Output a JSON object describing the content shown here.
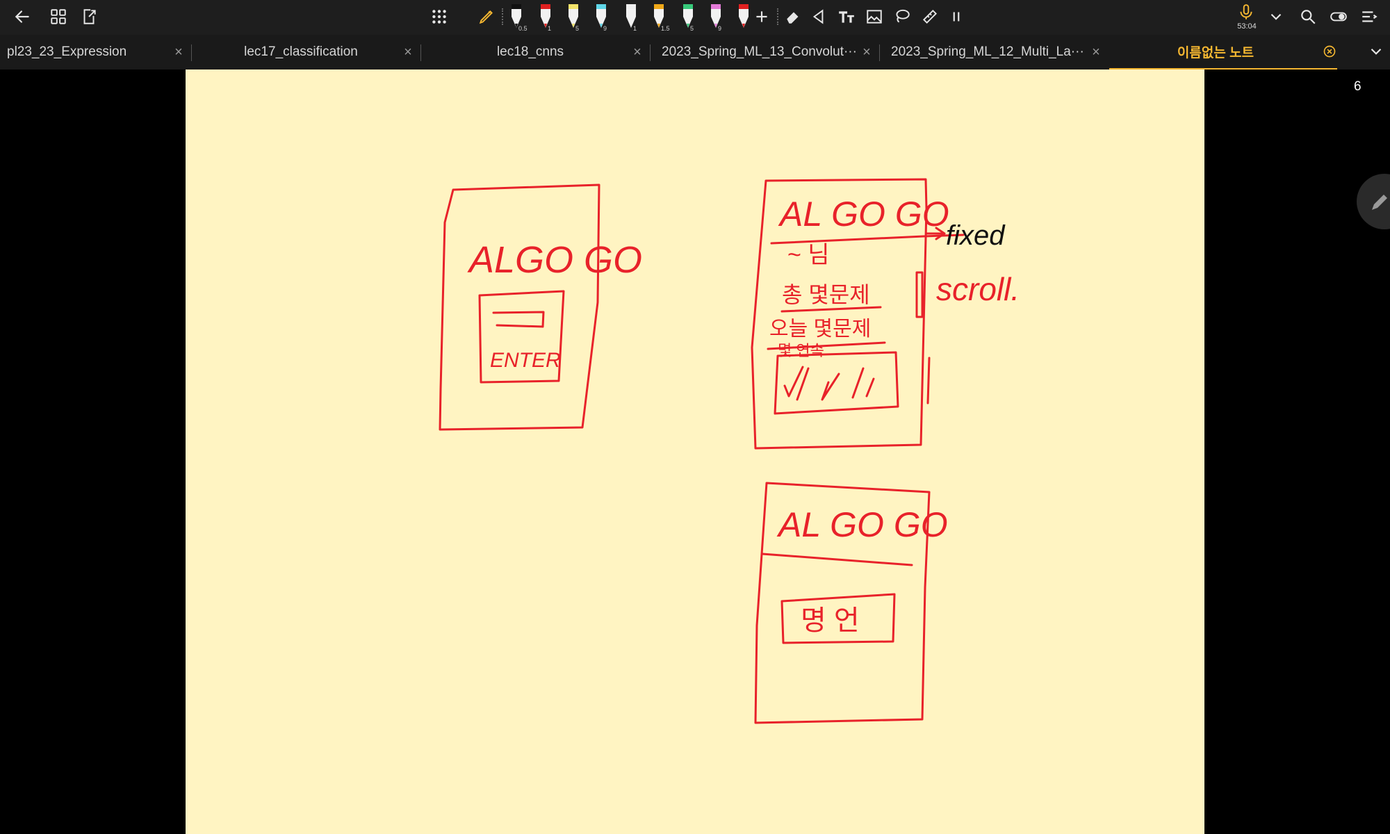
{
  "toolbar": {
    "left_icons": [
      "back-arrow-icon",
      "grid-view-icon",
      "export-icon"
    ],
    "pens": [
      {
        "name": "black-pen",
        "color": "#111111",
        "size": "0.5"
      },
      {
        "name": "red-pen",
        "color": "#e02020",
        "size": "1"
      },
      {
        "name": "yellow-highlighter",
        "color": "#f3e36a",
        "size": "5"
      },
      {
        "name": "cyan-highlighter",
        "color": "#5fd6e8",
        "size": "9"
      },
      {
        "name": "white-fountain-pen",
        "color": "#eeeeee",
        "size": "1"
      },
      {
        "name": "orange-fountain-pen",
        "color": "#f0a818",
        "size": "1.5"
      },
      {
        "name": "green-highlighter",
        "color": "#37c97a",
        "size": "5"
      },
      {
        "name": "pink-highlighter",
        "color": "#e47ad8",
        "size": "9"
      },
      {
        "name": "red-highlighter",
        "color": "#e02020",
        "size": ""
      }
    ],
    "right_tools": [
      "eraser-icon",
      "selection-icon",
      "text-tool-icon",
      "image-icon",
      "lasso-icon",
      "ruler-icon",
      "pause-icon"
    ],
    "timer": "53:04"
  },
  "tabs": [
    {
      "label": "pl23_23_Expression",
      "active": false
    },
    {
      "label": "lec17_classification",
      "active": false
    },
    {
      "label": "lec18_cnns",
      "active": false
    },
    {
      "label": "2023_Spring_ML_13_Convolut···",
      "active": false
    },
    {
      "label": "2023_Spring_ML_12_Multi_La···",
      "active": false
    },
    {
      "label": "이름없는 노트",
      "active": true
    }
  ],
  "tab_count": "6",
  "colors": {
    "accent": "#f5b731",
    "ink": "#e8222a",
    "paper": "#fff4c2"
  },
  "sketch": {
    "mock1": {
      "title": "ALGO GO",
      "button": "ENTER"
    },
    "mock2": {
      "title": "AL GO GO",
      "lines": [
        "~ 님",
        "총 몇문제",
        "오늘 몇문제",
        "몇 연속"
      ],
      "note_fixed": "fixed",
      "note_scroll": "scroll."
    },
    "mock3": {
      "title": "AL GO GO",
      "button": "명 언"
    }
  }
}
